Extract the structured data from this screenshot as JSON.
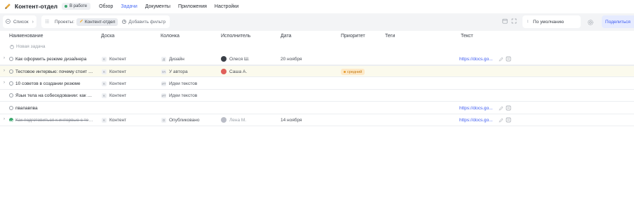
{
  "header": {
    "title": "Контент-отдел",
    "status": "В работе",
    "nav": [
      "Обзор",
      "Задачи",
      "Документы",
      "Приложения",
      "Настройки"
    ],
    "active_nav": "Задачи"
  },
  "toolbar": {
    "view_label": "Список",
    "projects_label": "Проекты:",
    "project_chip": "Контент-отдел",
    "add_filter": "Добавить фильтр",
    "sort_label": "По умолчанию",
    "share_label": "Поделиться"
  },
  "table": {
    "columns": [
      "Наименование",
      "Доска",
      "Колонка",
      "Исполнитель",
      "Дата",
      "Приоритет",
      "Теги",
      "Текст"
    ],
    "new_task": "Новая задача",
    "rows": [
      {
        "name": "Как оформить резюме дизайнера",
        "board": "Контент",
        "column": "Дизайн",
        "column_icon": "Д",
        "assignee": "Олеся Ш.",
        "avatar_color": "#3a3f47",
        "date": "20 ноября",
        "priority": "",
        "link": "https://docs.go...",
        "expandable": true,
        "done": false
      },
      {
        "name": "Тестовое интервью: почему стоит пр...",
        "board": "Контент",
        "column": "У автора",
        "column_icon": "УА",
        "assignee": "Саша А.",
        "avatar_color": "#e0605a",
        "date": "",
        "priority": "средний",
        "link": "",
        "expandable": true,
        "done": false
      },
      {
        "name": "10 советов в создании резюме",
        "board": "Контент",
        "column": "Идеи текстов",
        "column_icon": "ИТ",
        "assignee": "",
        "avatar_color": "",
        "date": "",
        "priority": "",
        "link": "",
        "expandable": true,
        "done": false
      },
      {
        "name": "Язык тела на собеседовании: как пр...",
        "board": "Контент",
        "column": "Идеи текстов",
        "column_icon": "ИТ",
        "assignee": "",
        "avatar_color": "",
        "date": "",
        "priority": "",
        "link": "",
        "expandable": false,
        "done": false
      },
      {
        "name": "пвапавпва",
        "board": "",
        "column": "",
        "column_icon": "",
        "assignee": "",
        "avatar_color": "",
        "date": "",
        "priority": "",
        "link": "https://docs.go...",
        "expandable": false,
        "done": false
      },
      {
        "name": "Как подготовиться к интервью с теп...",
        "board": "Контент",
        "column": "Опубликовано",
        "column_icon": "О",
        "assignee": "Лена М.",
        "avatar_color": "#b9bcc6",
        "date": "14 ноября",
        "priority": "",
        "link": "https://docs.go...",
        "expandable": true,
        "done": true
      }
    ]
  },
  "colors": {
    "accent": "#4c6ef5",
    "status_green": "#3aa76d",
    "priority_bg": "#fde9c8",
    "highlight_row": "#fbfaed"
  }
}
